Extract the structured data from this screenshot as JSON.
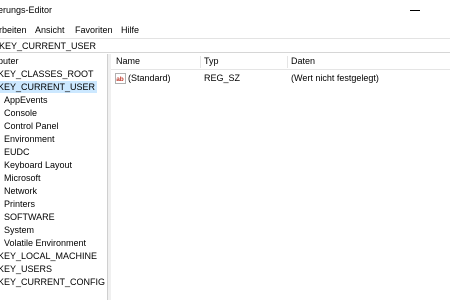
{
  "window": {
    "title": "erungs-Editor"
  },
  "menu": {
    "items": [
      "rbeiten",
      "Ansicht",
      "Favoriten",
      "Hilfe"
    ]
  },
  "address": {
    "path": "KEY_CURRENT_USER"
  },
  "tree": {
    "items": [
      {
        "label": "puter"
      },
      {
        "label": "KEY_CLASSES_ROOT"
      },
      {
        "label": "KEY_CURRENT_USER",
        "selected": true
      },
      {
        "label": "AppEvents"
      },
      {
        "label": "Console"
      },
      {
        "label": "Control Panel"
      },
      {
        "label": "Environment"
      },
      {
        "label": "EUDC"
      },
      {
        "label": "Keyboard Layout"
      },
      {
        "label": "Microsoft"
      },
      {
        "label": "Network"
      },
      {
        "label": "Printers"
      },
      {
        "label": "SOFTWARE"
      },
      {
        "label": "System"
      },
      {
        "label": "Volatile Environment"
      },
      {
        "label": "KEY_LOCAL_MACHINE"
      },
      {
        "label": "KEY_USERS"
      },
      {
        "label": "KEY_CURRENT_CONFIG"
      }
    ]
  },
  "list": {
    "columns": [
      "Name",
      "Typ",
      "Daten"
    ],
    "rows": [
      {
        "name": "(Standard)",
        "type": "REG_SZ",
        "data": "(Wert nicht festgelegt)",
        "icon": "string-value-icon"
      }
    ]
  },
  "colors": {
    "selection": "#cce8ff",
    "icon_red": "#c0392b"
  }
}
